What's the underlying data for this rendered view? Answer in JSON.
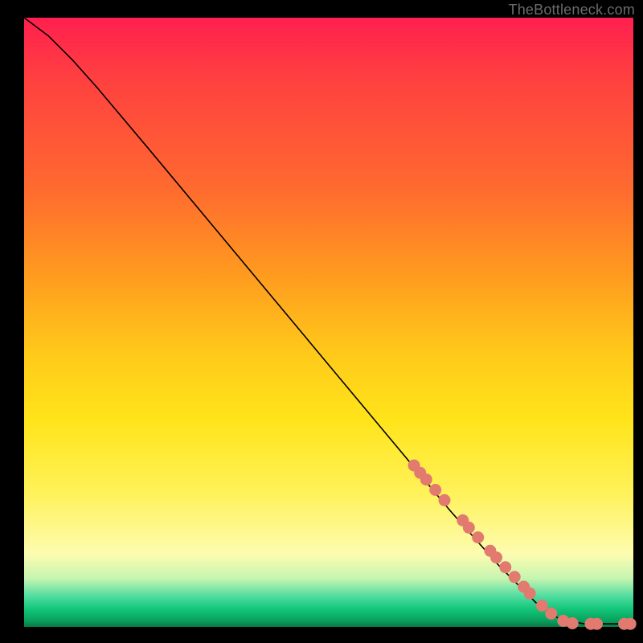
{
  "attribution": "TheBottleneck.com",
  "chart_data": {
    "type": "line",
    "title": "",
    "xlabel": "",
    "ylabel": "",
    "xlim": [
      0,
      100
    ],
    "ylim": [
      0,
      100
    ],
    "curve": [
      {
        "x": 0,
        "y": 100
      },
      {
        "x": 4,
        "y": 97
      },
      {
        "x": 8,
        "y": 93
      },
      {
        "x": 12,
        "y": 88.5
      },
      {
        "x": 20,
        "y": 79
      },
      {
        "x": 30,
        "y": 67
      },
      {
        "x": 40,
        "y": 55
      },
      {
        "x": 50,
        "y": 43
      },
      {
        "x": 60,
        "y": 31
      },
      {
        "x": 70,
        "y": 19
      },
      {
        "x": 78,
        "y": 10
      },
      {
        "x": 84,
        "y": 4
      },
      {
        "x": 88,
        "y": 1.2
      },
      {
        "x": 92,
        "y": 0.5
      },
      {
        "x": 100,
        "y": 0.5
      }
    ],
    "series": [
      {
        "name": "highlighted-points",
        "color": "#e27a6f",
        "points": [
          {
            "x": 64,
            "y": 26.5
          },
          {
            "x": 65,
            "y": 25.3
          },
          {
            "x": 66,
            "y": 24.2
          },
          {
            "x": 67.5,
            "y": 22.5
          },
          {
            "x": 69,
            "y": 20.8
          },
          {
            "x": 72,
            "y": 17.5
          },
          {
            "x": 73,
            "y": 16.3
          },
          {
            "x": 74.5,
            "y": 14.7
          },
          {
            "x": 76.5,
            "y": 12.5
          },
          {
            "x": 77.5,
            "y": 11.4
          },
          {
            "x": 79,
            "y": 9.8
          },
          {
            "x": 80.5,
            "y": 8.2
          },
          {
            "x": 82,
            "y": 6.6
          },
          {
            "x": 83,
            "y": 5.5
          },
          {
            "x": 85,
            "y": 3.5
          },
          {
            "x": 86.5,
            "y": 2.2
          },
          {
            "x": 88.5,
            "y": 1.0
          },
          {
            "x": 90,
            "y": 0.6
          },
          {
            "x": 93,
            "y": 0.5
          },
          {
            "x": 94,
            "y": 0.5
          },
          {
            "x": 98.5,
            "y": 0.5
          },
          {
            "x": 99.5,
            "y": 0.5
          }
        ]
      }
    ]
  },
  "colors": {
    "bg": "#000000",
    "marker": "#e27a6f",
    "curve": "#000000",
    "attribution": "#6b6b6b"
  }
}
